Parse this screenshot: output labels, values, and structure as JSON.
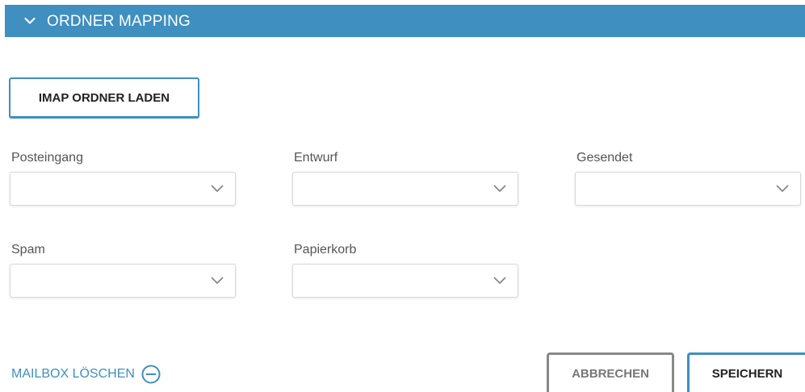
{
  "section": {
    "title": "ORDNER MAPPING",
    "toggle_icon": "chevron-down-icon",
    "header_color": "#3f8fc0"
  },
  "load_button": {
    "label": "IMAP ORDNER LADEN"
  },
  "fields": {
    "inbox": {
      "label": "Posteingang",
      "value": ""
    },
    "draft": {
      "label": "Entwurf",
      "value": ""
    },
    "sent": {
      "label": "Gesendet",
      "value": ""
    },
    "spam": {
      "label": "Spam",
      "value": ""
    },
    "trash": {
      "label": "Papierkorb",
      "value": ""
    }
  },
  "footer": {
    "delete_label": "MAILBOX LÖSCHEN",
    "delete_icon": "minus-circle-icon",
    "cancel_label": "ABBRECHEN",
    "save_label": "SPEICHERN"
  }
}
